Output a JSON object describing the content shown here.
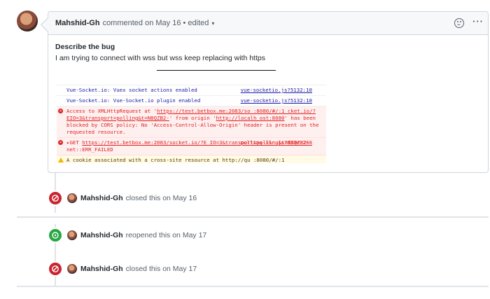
{
  "comment": {
    "author": "Mahshid-Gh",
    "meta": "commented on May 16 • edited",
    "caret": "▾",
    "title": "Describe the bug",
    "text": "I am trying to connect with wss but wss keep replacing with https"
  },
  "console": {
    "lines": [
      {
        "type": "info",
        "text": "Vue-Socket.io: Vuex socket actions enabled",
        "src": "vue-socketio.js?5132:10"
      },
      {
        "type": "info",
        "text": "Vue-Socket.io: Vue-Socket.io plugin enabled",
        "src": "vue-socketio.js?5132:10"
      },
      {
        "type": "error",
        "text_a": "Access to XMLHttpRequest at '",
        "url": "https://test.betbox.me:2083/so :8080/#/:1 cket.io/?EIO=3&transport=polling&t=N8QZB2-",
        "text_b": "' from origin '",
        "origin": "http://localh ost:8080",
        "text_c": "' has been blocked by CORS policy: No 'Access-Control-Allow-Origin' header is present on the requested resource."
      },
      {
        "type": "error",
        "text_a": "▸GET ",
        "url": "https://test.betbox.me:2083/socket.io/?E IO=3&transport=polling&t=N8QZB2-",
        "src": "polling-xhr.js?d33e:268",
        "text_b": " net::ERR_FAILED"
      },
      {
        "type": "warn",
        "text": "A cookie associated with a cross-site resource at http://qu :8080/#/:1"
      }
    ]
  },
  "events": [
    {
      "author": "Mahshid-Gh",
      "action": "closed this on May 16",
      "kind": "closed"
    },
    {
      "author": "Mahshid-Gh",
      "action": "reopened this on May 17",
      "kind": "open"
    },
    {
      "author": "Mahshid-Gh",
      "action": "closed this on May 17",
      "kind": "closed"
    }
  ],
  "colors": {
    "closed": "#cb2431",
    "open": "#28a745",
    "error": "#e01e1e",
    "info": "#1a1aa6"
  }
}
